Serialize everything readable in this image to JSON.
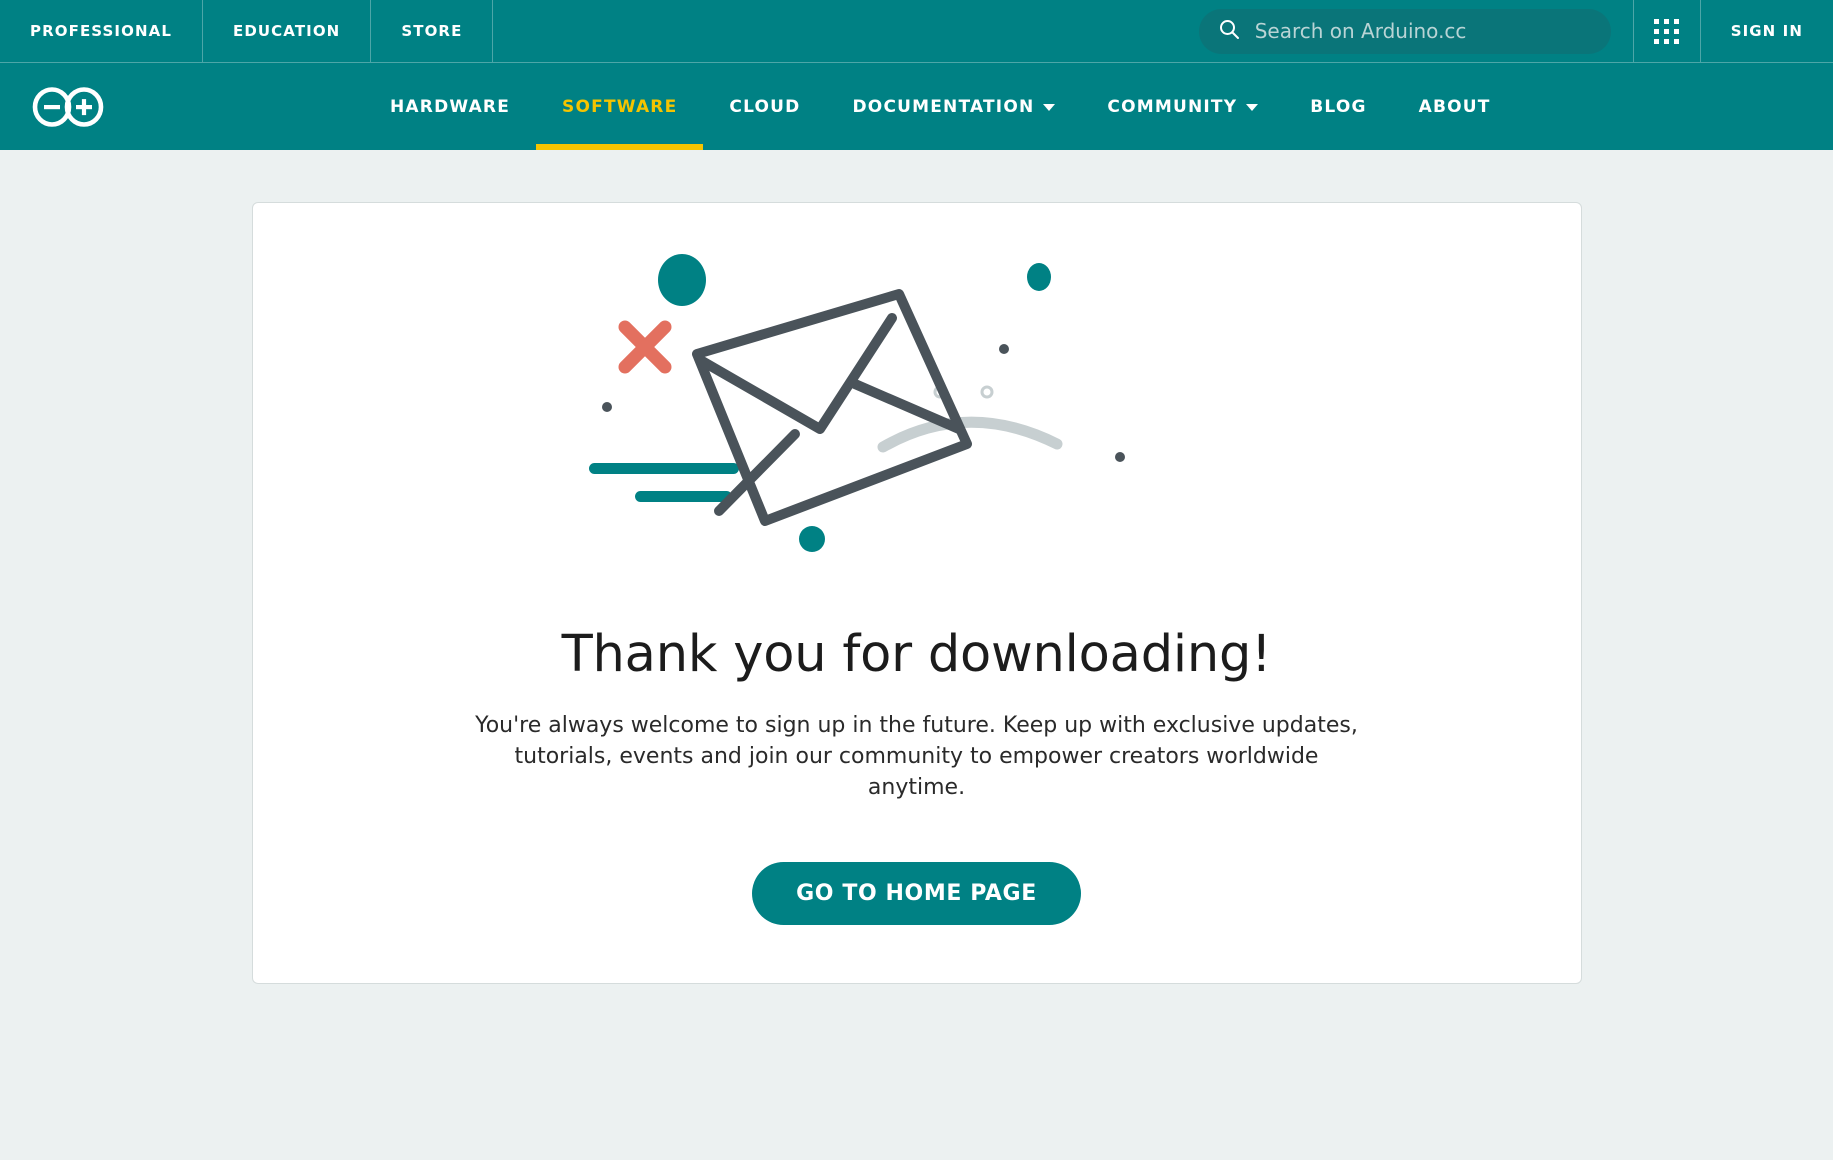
{
  "theme": {
    "teal": "#008184",
    "teal_dark": "#0a7579",
    "yellow": "#f5c400",
    "page_bg": "#ecf1f1",
    "card_bg": "#ffffff",
    "envelope_gray": "#4a535a",
    "accent_red": "#e3705f",
    "light_gray": "#c7cfd1"
  },
  "utility_bar": {
    "links": [
      {
        "label": "PROFESSIONAL",
        "name": "utility-link-professional"
      },
      {
        "label": "EDUCATION",
        "name": "utility-link-education"
      },
      {
        "label": "STORE",
        "name": "utility-link-store"
      }
    ],
    "search": {
      "placeholder": "Search on Arduino.cc",
      "value": "",
      "icon": "search-icon"
    },
    "apps_icon": "apps-grid-icon",
    "signin_label": "SIGN IN"
  },
  "main_nav": {
    "logo": "arduino-infinity-logo",
    "items": [
      {
        "label": "HARDWARE",
        "name": "nav-item-hardware",
        "active": false,
        "has_caret": false
      },
      {
        "label": "SOFTWARE",
        "name": "nav-item-software",
        "active": true,
        "has_caret": false
      },
      {
        "label": "CLOUD",
        "name": "nav-item-cloud",
        "active": false,
        "has_caret": false
      },
      {
        "label": "DOCUMENTATION",
        "name": "nav-item-documentation",
        "active": false,
        "has_caret": true
      },
      {
        "label": "COMMUNITY",
        "name": "nav-item-community",
        "active": false,
        "has_caret": true
      },
      {
        "label": "BLOG",
        "name": "nav-item-blog",
        "active": false,
        "has_caret": false
      },
      {
        "label": "ABOUT",
        "name": "nav-item-about",
        "active": false,
        "has_caret": false
      }
    ]
  },
  "main": {
    "illustration_name": "tilted-envelope-illustration",
    "headline": "Thank you for downloading!",
    "subtext": "You're always welcome to sign up in the future. Keep up with exclusive updates, tutorials, events and join our community to empower creators worldwide anytime.",
    "cta_label": "GO TO HOME PAGE"
  }
}
